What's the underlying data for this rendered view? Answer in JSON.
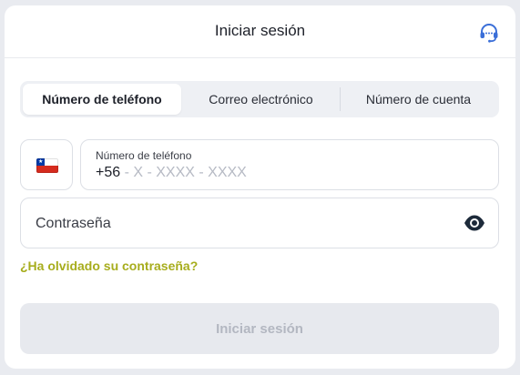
{
  "header": {
    "title": "Iniciar sesión",
    "support_icon": "headset-icon"
  },
  "tabs": [
    {
      "label": "Número de teléfono",
      "active": true
    },
    {
      "label": "Correo electrónico",
      "active": false
    },
    {
      "label": "Número de cuenta",
      "active": false
    }
  ],
  "phone": {
    "country_flag": "chile-flag-icon",
    "label": "Número de teléfono",
    "prefix": "+56",
    "mask": " - X - XXXX - XXXX"
  },
  "password": {
    "placeholder": "Contraseña",
    "toggle_icon": "eye-icon"
  },
  "forgot_link": "¿Ha olvidado su contraseña?",
  "submit_label": "Iniciar sesión",
  "colors": {
    "background": "#e9ebf0",
    "card": "#ffffff",
    "accent_link": "#a7ad1d",
    "icon_blue": "#3b6fd8",
    "disabled_button": "#e7e9ee",
    "disabled_text": "#b3b7c1"
  }
}
